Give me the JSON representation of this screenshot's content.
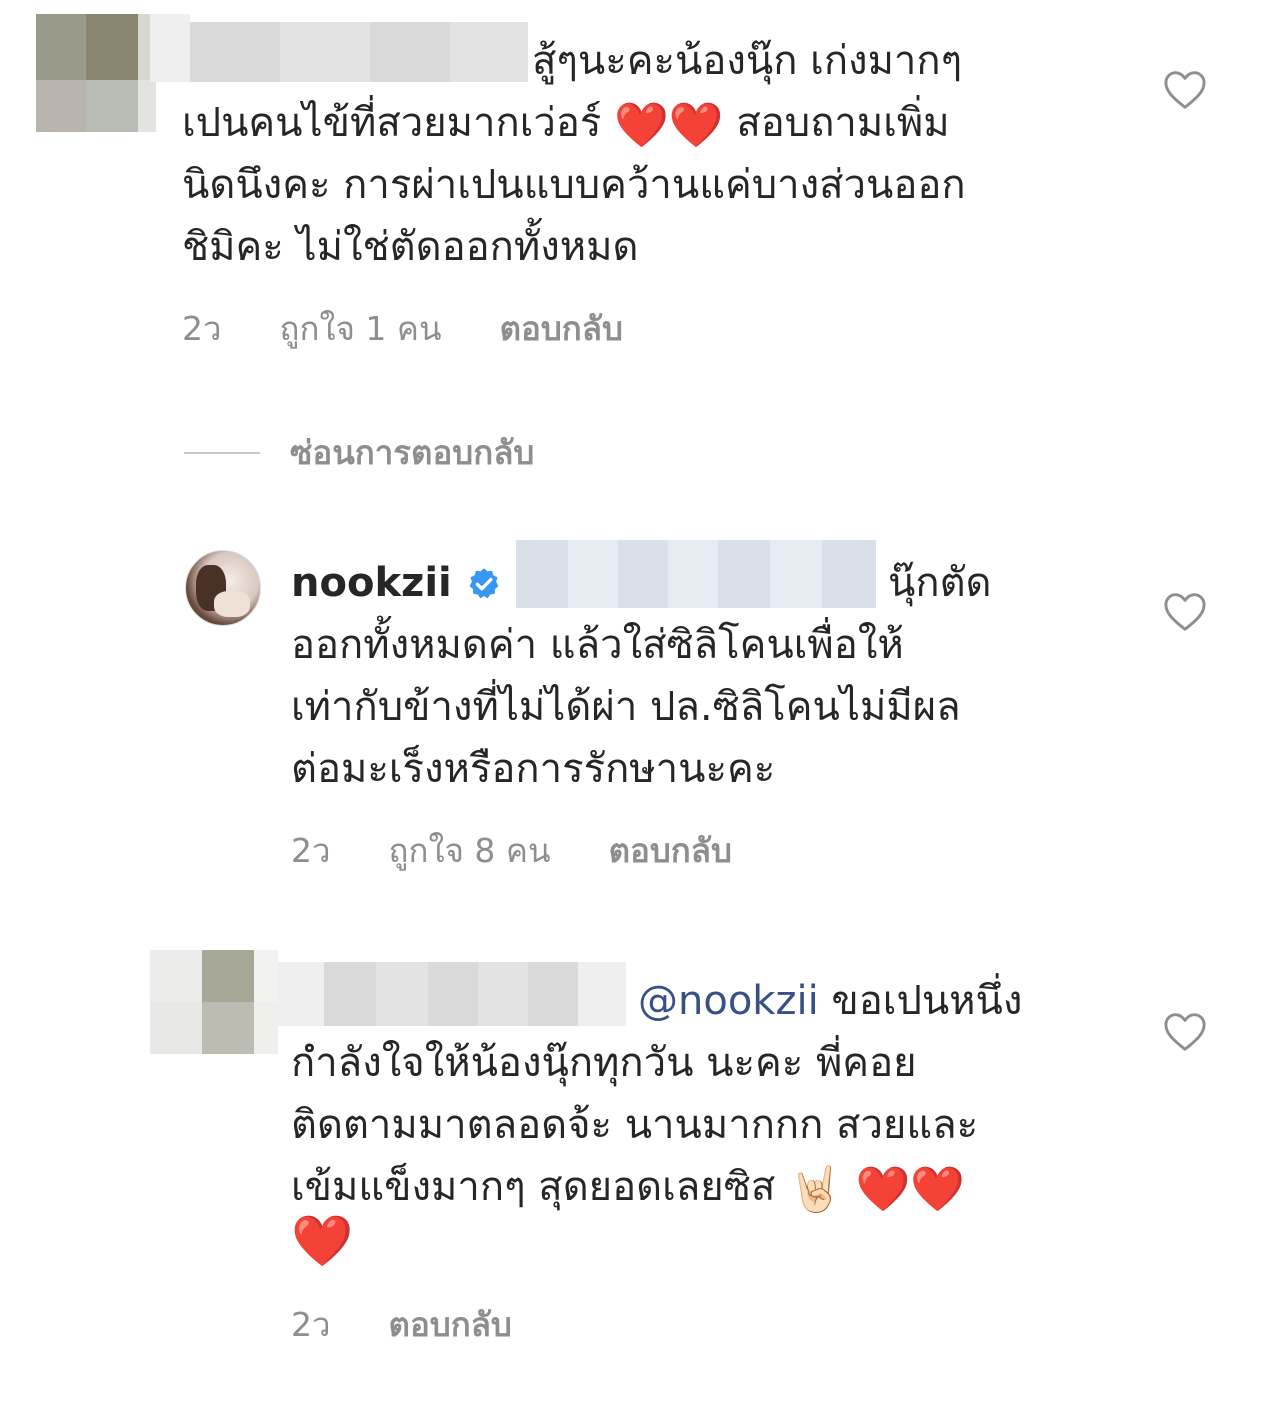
{
  "colors": {
    "text": "#262626",
    "muted": "#8e8e8e",
    "mention": "#385185",
    "verified": "#3897f0",
    "heart_emoji": "#e0141e"
  },
  "comments": [
    {
      "id": "c1",
      "lines": [
        "สู้ๆนะคะน้องนุ๊ก เก่งมากๆ",
        "เปนคนไข้ที่สวยมากเว่อร์",
        "สอบถามเพิ่ม",
        "นิดนึงคะ การผ่าเปนแบบคว้านแค่บางส่วนออก",
        "ชิมิคะ ไม่ใช่ตัดออกทั้งหมด"
      ],
      "time": "2ว",
      "likes": "ถูกใจ 1 คน",
      "reply": "ตอบกลับ"
    },
    {
      "id": "c2",
      "username": "nookzii",
      "lines": [
        "นุ๊กตัด",
        "ออกทั้งหมดค่า แล้วใส่ซิลิโคนเพื่อให้",
        "เท่ากับข้างที่ไม่ได้ผ่า ปล.ซิลิโคนไม่มีผล",
        "ต่อมะเร็งหรือการรักษานะคะ"
      ],
      "time": "2ว",
      "likes": "ถูกใจ 8 คน",
      "reply": "ตอบกลับ"
    },
    {
      "id": "c3",
      "mention": "@nookzii",
      "lines": [
        "ขอเปนหนึ่ง",
        "กำลังใจให้น้องนุ๊กทุกวัน นะคะ พี่คอย",
        "ติดตามมาตลอดจ้ะ นานมากกก สวยและ",
        "เข้มแข็งมากๆ สุดยอดเลยซิส"
      ],
      "time": "2ว",
      "reply": "ตอบกลับ"
    }
  ],
  "hide_replies": "ซ่อนการตอบกลับ",
  "icons": {
    "like": "heart-outline-icon",
    "verified": "verified-badge-icon",
    "emoji_heart": "red-heart-emoji",
    "emoji_rock": "sign-of-horns-emoji"
  }
}
